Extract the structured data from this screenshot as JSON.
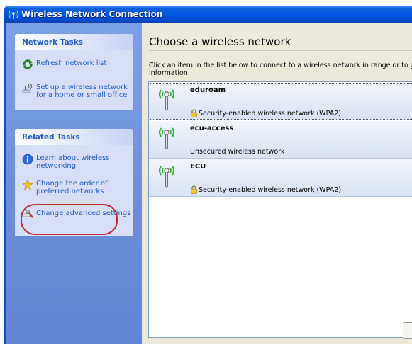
{
  "window": {
    "title": "Wireless Network Connection"
  },
  "sidebar": {
    "network_tasks": {
      "header": "Network Tasks",
      "items": [
        {
          "label": "Refresh network list",
          "icon": "refresh-icon"
        },
        {
          "label": "Set up a wireless network for a home or small office",
          "icon": "wireless-setup-icon"
        }
      ]
    },
    "related_tasks": {
      "header": "Related Tasks",
      "items": [
        {
          "label": "Learn about wireless networking",
          "icon": "info-icon"
        },
        {
          "label": "Change the order of preferred networks",
          "icon": "star-icon"
        },
        {
          "label": "Change advanced settings",
          "icon": "settings-icon"
        }
      ]
    }
  },
  "main": {
    "heading": "Choose a wireless network",
    "instruction_line1": "Click an item in the list below to connect to a wireless network in range or to get m",
    "instruction_line2": "information.",
    "networks": [
      {
        "name": "eduroam",
        "security": "Security-enabled wireless network (WPA2)",
        "secured": true,
        "selected": true
      },
      {
        "name": "ecu-access",
        "security": "Unsecured wireless network",
        "secured": false,
        "selected": false
      },
      {
        "name": "ECU",
        "security": "Security-enabled wireless network (WPA2)",
        "secured": true,
        "selected": false
      }
    ]
  },
  "colors": {
    "title_bar": "#0055E5",
    "sidebar": "#6B8FD6",
    "task_link": "#215DC6",
    "highlight_circle": "#C0282D"
  }
}
